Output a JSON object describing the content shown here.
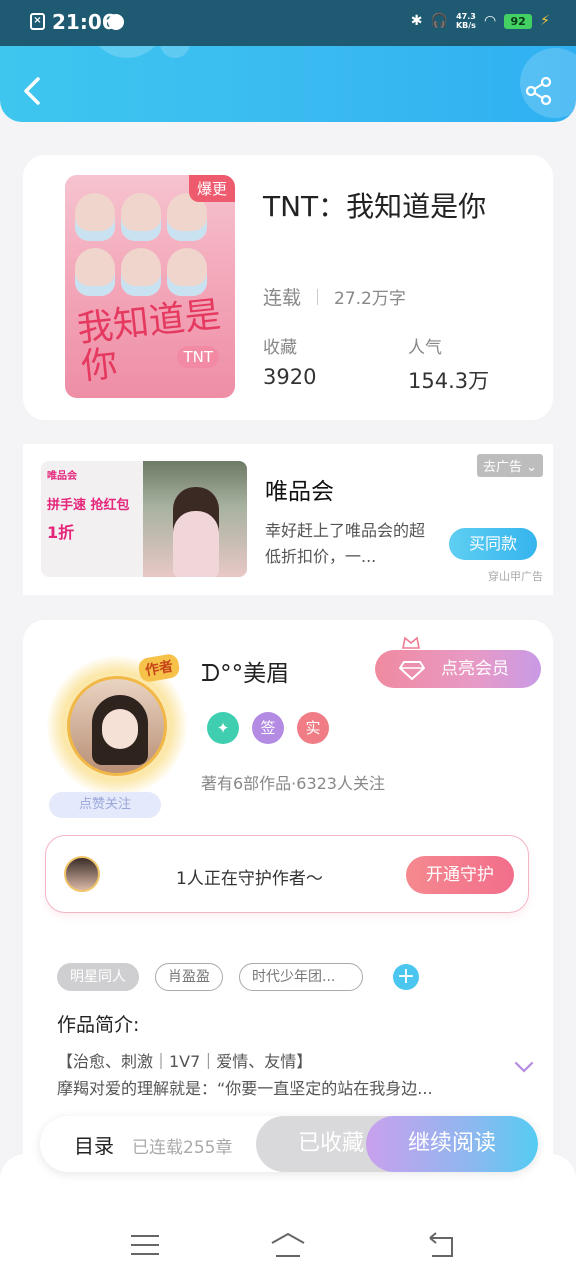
{
  "status_bar": {
    "time": "21:06",
    "net_speed_value": "47.3",
    "net_speed_unit": "KB/s",
    "battery": "92"
  },
  "header": {
    "icons": [
      "back-arrow-icon",
      "share-icon"
    ]
  },
  "book": {
    "title": "TNT：我知道是你",
    "cover_title": "我知道是你",
    "cover_badge": "TNT",
    "hot_tag": "爆更",
    "status": "连载",
    "word_count": "27.2万字",
    "stats": [
      {
        "label": "收藏",
        "value": "3920"
      },
      {
        "label": "人气",
        "value": "154.3万"
      }
    ]
  },
  "ad": {
    "image_brand": "唯品会",
    "image_slogan": "拼手速 抢红包",
    "image_price": "1折",
    "title": "唯品会",
    "description": "幸好赶上了唯品会的超低折扣价，一...",
    "button": "买同款",
    "tag": "去广告",
    "source": "穿山甲广告"
  },
  "author": {
    "name": "ᗪ°°美眉",
    "avatar_badge": "作者",
    "like_follow": "点赞关注",
    "vip_button": "点亮会员",
    "badges": [
      {
        "label": "",
        "color": "#3fcfb0"
      },
      {
        "label": "签",
        "color": "#b48be2"
      },
      {
        "label": "实",
        "color": "#f07c86"
      }
    ],
    "stats": "著有6部作品·6323人关注",
    "guard_text": "1人正在守护作者～",
    "guard_button": "开通守护"
  },
  "tags": [
    "明星同人",
    "肖盈盈",
    "时代少年团..."
  ],
  "intro": {
    "label": "作品简介:",
    "line1": "【治愈、刺激｜1V7｜爱情、友情】",
    "line2": "摩羯对爱的理解就是：“你要一直坚定的站在我身边..."
  },
  "bottom_bar": {
    "toc": "目录",
    "chapter_count": "已连载255章",
    "collected": "已收藏",
    "continue": "继续阅读"
  },
  "colors": {
    "accent": "#3ec6ef",
    "pink": "#f26e8b"
  }
}
